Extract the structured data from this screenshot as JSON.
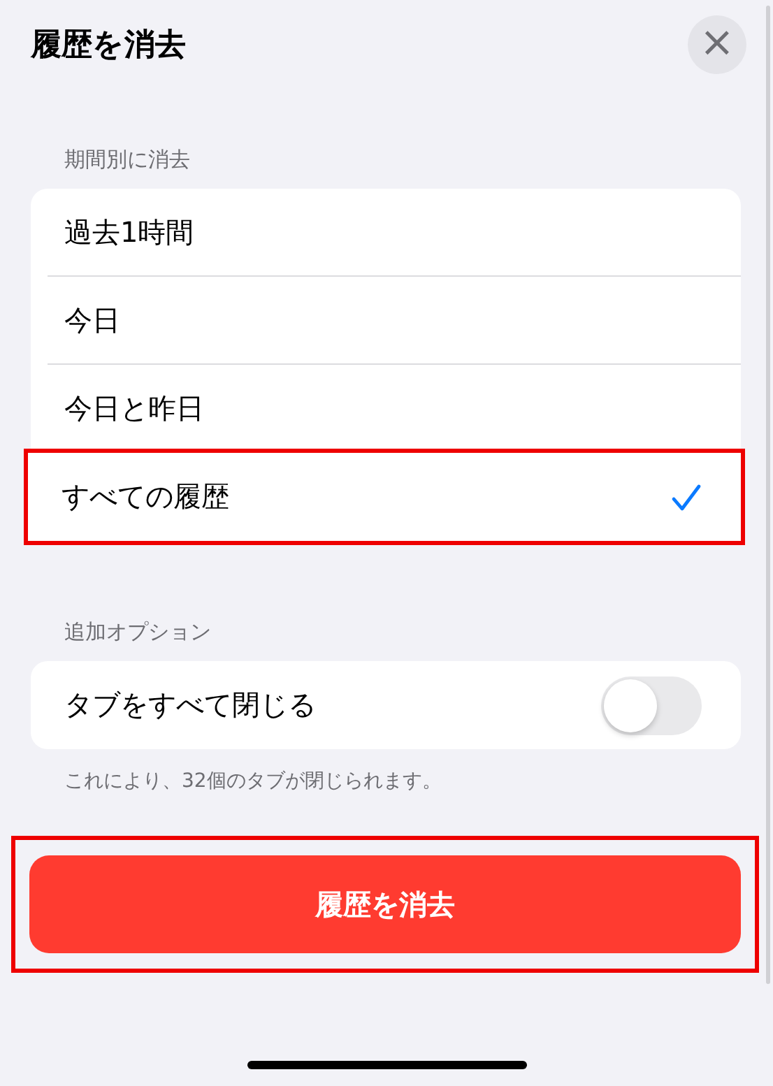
{
  "title": "履歴を消去",
  "close": {
    "icon": "×"
  },
  "period_section": {
    "label": "期間別に消去",
    "options": [
      {
        "label": "過去1時間",
        "selected": false,
        "highlighted": false
      },
      {
        "label": "今日",
        "selected": false,
        "highlighted": false
      },
      {
        "label": "今日と昨日",
        "selected": false,
        "highlighted": false
      },
      {
        "label": "すべての履歴",
        "selected": true,
        "highlighted": true
      }
    ]
  },
  "options_section": {
    "label": "追加オプション",
    "toggles": [
      {
        "label": "タブをすべて閉じる",
        "on": false
      }
    ],
    "footnote": "これにより、32個のタブが閉じられます。"
  },
  "clear_button": {
    "label": "履歴を消去",
    "highlighted": true
  }
}
